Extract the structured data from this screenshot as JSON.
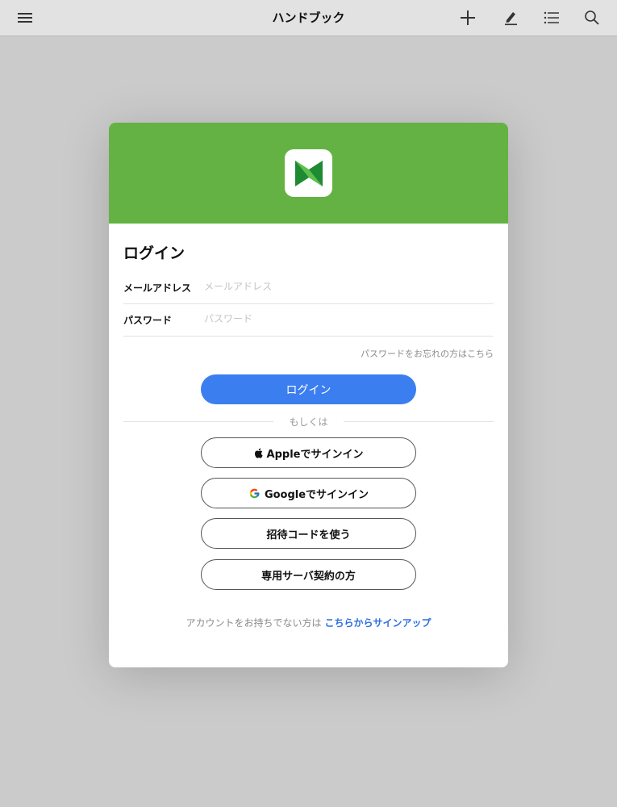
{
  "topbar": {
    "title": "ハンドブック",
    "icons": [
      "menu-icon",
      "plus-icon",
      "pen-icon",
      "list-icon",
      "search-icon"
    ]
  },
  "login": {
    "heading": "ログイン",
    "email_label": "メールアドレス",
    "email_placeholder": "メールアドレス",
    "email_value": "",
    "password_label": "パスワード",
    "password_placeholder": "パスワード",
    "password_value": "",
    "forgot_password": "パスワードをお忘れの方はこちら",
    "login_button": "ログイン",
    "or_text": "もしくは",
    "apple_button": "Appleでサインイン",
    "google_button": "Googleでサインイン",
    "invite_button": "招待コードを使う",
    "dedicated_server_button": "専用サーバ契約の方",
    "signup_prompt": "アカウントをお持ちでない方は",
    "signup_link": "こちらからサインアップ"
  },
  "colors": {
    "header_green": "#64b244",
    "primary_blue": "#3b7ef0",
    "link_blue": "#2f6fe0",
    "backdrop": "#cbcbcb"
  }
}
